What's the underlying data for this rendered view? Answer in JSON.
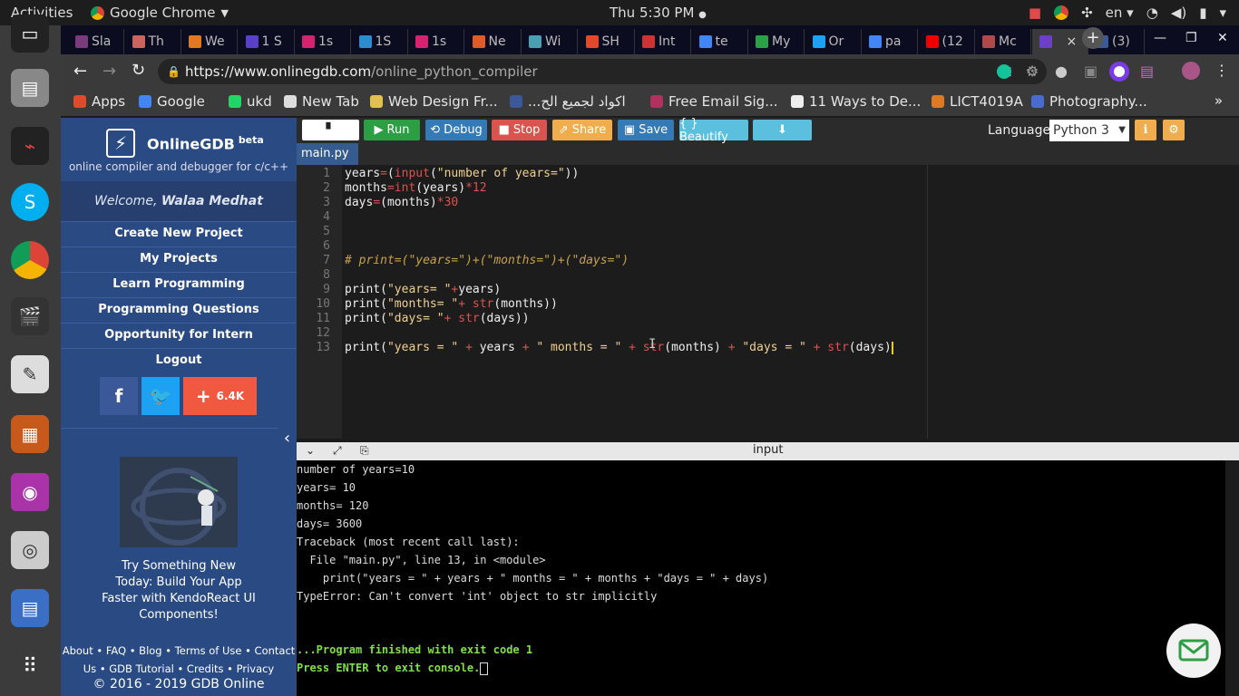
{
  "system": {
    "activities": "Activities",
    "app_menu": "Google Chrome",
    "clock": "Thu  5:30 PM",
    "lang": "en"
  },
  "tabs": [
    {
      "label": "Sla",
      "color": "#7b3a7b"
    },
    {
      "label": "Th",
      "color": "#c9645f"
    },
    {
      "label": "We",
      "color": "#e07a22"
    },
    {
      "label": "1 S",
      "color": "#5a3fc7"
    },
    {
      "label": "1s",
      "color": "#d6226f"
    },
    {
      "label": "1S",
      "color": "#2d8ccd"
    },
    {
      "label": "1s",
      "color": "#d6226f"
    },
    {
      "label": "Ne",
      "color": "#e05a2a"
    },
    {
      "label": "Wi",
      "color": "#4aa0b0"
    },
    {
      "label": "SH",
      "color": "#e04a2a"
    },
    {
      "label": "Int",
      "color": "#c33"
    },
    {
      "label": "te",
      "color": "#4285f4"
    },
    {
      "label": "My",
      "color": "#2aa145"
    },
    {
      "label": "Or",
      "color": "#1da1f2"
    },
    {
      "label": "pa",
      "color": "#4285f4"
    },
    {
      "label": "(12",
      "color": "#e00"
    },
    {
      "label": "Mc",
      "color": "#b04a4a"
    },
    {
      "label": "",
      "color": "#6c3fc7",
      "active": true
    },
    {
      "label": "(3)",
      "color": "#3b5998"
    }
  ],
  "omnibox": {
    "url_host": "https://www.onlinegdb.com",
    "url_path": "/online_python_compiler"
  },
  "bookmarks": [
    {
      "label": "Apps",
      "color": "#e04a2a"
    },
    {
      "label": "Google",
      "color": "#4285f4"
    },
    {
      "label": "ukd",
      "color": "#25d366"
    },
    {
      "label": "New Tab",
      "color": "#ddd"
    },
    {
      "label": "Web Design Fr...",
      "color": "#e0c050"
    },
    {
      "label": "...اكواد لجميع الح",
      "color": "#3b5998"
    },
    {
      "label": "Free Email Sig...",
      "color": "#b03060"
    },
    {
      "label": "11 Ways to De...",
      "color": "#eee"
    },
    {
      "label": "LICT4019A",
      "color": "#e07a22"
    },
    {
      "label": "Photography...",
      "color": "#4a6ad0"
    }
  ],
  "sidebar": {
    "brand": "OnlineGDB",
    "brand_sup": "beta",
    "tagline": "online compiler and debugger for c/c++",
    "welcome_prefix": "Welcome, ",
    "welcome_name": "Walaa Medhat",
    "nav": [
      "Create New Project",
      "My Projects",
      "Learn Programming",
      "Programming Questions",
      "Opportunity for Intern",
      "Logout"
    ],
    "share_count": "6.4K",
    "ad_lines": [
      "Try Something New",
      "Today: Build Your App",
      "Faster with KendoReact UI",
      "Components!"
    ],
    "footer_line1": "About • FAQ • Blog • Terms of Use • Contact",
    "footer_line2": "Us • GDB Tutorial • Credits • Privacy",
    "copyright": "© 2016 - 2019 GDB Online"
  },
  "toolbar": {
    "run": "Run",
    "debug": "Debug",
    "stop": "Stop",
    "share": "Share",
    "save": "Save",
    "beautify": "{ } Beautify",
    "language_label": "Language",
    "language_value": "Python 3"
  },
  "file_tab": "main.py",
  "editor": {
    "line_numbers": [
      "1",
      "2",
      "3",
      "4",
      "5",
      "6",
      "7",
      "8",
      "9",
      "10",
      "11",
      "12",
      "13"
    ]
  },
  "console": {
    "header": "input",
    "lines": [
      "number of years=10",
      "years= 10",
      "months= 120",
      "days= 3600",
      "Traceback (most recent call last):",
      "  File \"main.py\", line 13, in <module>",
      "    print(\"years = \" + years + \" months = \" + months + \"days = \" + days)",
      "TypeError: Can't convert 'int' object to str implicitly"
    ],
    "finished": "...Program finished with exit code 1",
    "press_enter": "Press ENTER to exit console."
  }
}
